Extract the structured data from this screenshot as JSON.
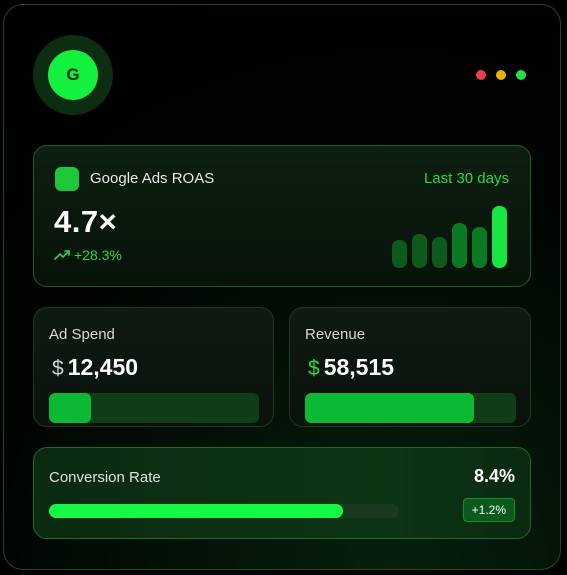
{
  "avatar": {
    "letter": "G",
    "color": "#13f03e"
  },
  "window_dots": [
    {
      "name": "red-dot",
      "color": "#e8414b"
    },
    {
      "name": "yellow-dot",
      "color": "#eab308"
    },
    {
      "name": "green-dot",
      "color": "#22e24a"
    }
  ],
  "roas": {
    "title": "Google Ads ROAS",
    "period": "Last 30 days",
    "value": "4.7×",
    "change": "+28.3%",
    "change_icon": "trending-up-icon",
    "accent": "#25d84a",
    "mini_bars": [
      0.45,
      0.55,
      0.5,
      0.72,
      0.66,
      1.0
    ]
  },
  "ad_spend": {
    "label": "Ad Spend",
    "currency": "$",
    "amount": "12,450",
    "progress": 0.2
  },
  "revenue": {
    "label": "Revenue",
    "currency": "$",
    "amount": "58,515",
    "progress": 0.8
  },
  "conversion": {
    "label": "Conversion Rate",
    "value": "8.4%",
    "change": "+1.2%",
    "progress": 0.84
  }
}
